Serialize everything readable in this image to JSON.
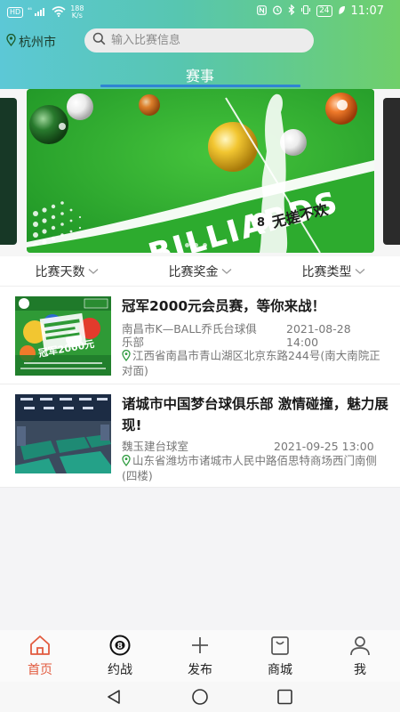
{
  "status_bar": {
    "network_badge": "HD",
    "signal_label": "⁴⁶",
    "net_speed_value": "188",
    "net_speed_unit": "K/s",
    "battery": "24",
    "time": "11:07"
  },
  "location": {
    "city": "杭州市"
  },
  "search": {
    "placeholder": "输入比赛信息"
  },
  "tabs": [
    {
      "label": "赛事",
      "active": true
    }
  ],
  "banner": {
    "text": "BILLIARDS",
    "slogan": "无搓不欢",
    "ball_number": "8"
  },
  "filters": [
    {
      "label": "比赛天数"
    },
    {
      "label": "比赛奖金"
    },
    {
      "label": "比赛类型"
    }
  ],
  "events": [
    {
      "title": "冠军2000元会员赛，等你来战！",
      "club": "南昌市K—BALL乔氏台球俱乐部",
      "datetime": "2021-08-28 14:00",
      "address": "江西省南昌市青山湖区北京东路244号(南大南院正对面)",
      "thumb_caption": "冠军2000元"
    },
    {
      "title": "诸城市中国梦台球俱乐部 激情碰撞，魅力展现!",
      "club": "魏玉建台球室",
      "datetime": "2021-09-25 13:00",
      "address": "山东省潍坊市诸城市人民中路佰思特商场西门南侧(四楼)"
    }
  ],
  "tabbar": [
    {
      "label": "首页",
      "icon": "home-icon",
      "active": true
    },
    {
      "label": "约战",
      "icon": "eight-ball-icon"
    },
    {
      "label": "发布",
      "icon": "plus-icon"
    },
    {
      "label": "商城",
      "icon": "shopping-bag-icon"
    },
    {
      "label": "我",
      "icon": "user-icon"
    }
  ],
  "colors": {
    "accent_active": "#e25b3f",
    "tab_underline": "#2f84d3",
    "pin_green": "#2e9b3f"
  }
}
